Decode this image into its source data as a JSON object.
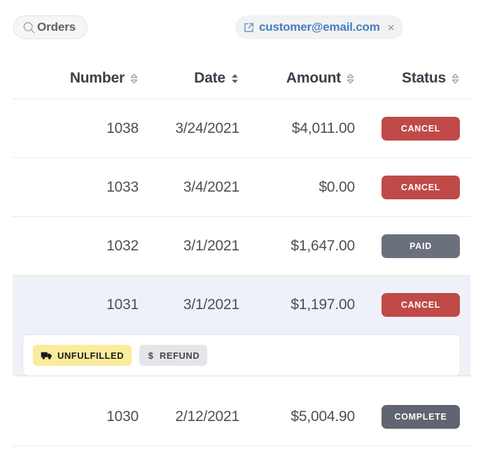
{
  "filter_bar": {
    "search_chip": {
      "icon": "search-icon",
      "label": "Orders"
    },
    "email_chip": {
      "icon": "external-link-icon",
      "label": "customer@email.com",
      "close": "×",
      "accent_color": "#4a7ebb"
    }
  },
  "table": {
    "columns": [
      {
        "key": "number",
        "label": "Number",
        "sort": "none",
        "align": "right"
      },
      {
        "key": "date",
        "label": "Date",
        "sort": "active",
        "align": "right"
      },
      {
        "key": "amount",
        "label": "Amount",
        "sort": "none",
        "align": "right"
      },
      {
        "key": "status",
        "label": "Status",
        "sort": "none",
        "align": "right"
      }
    ],
    "rows": [
      {
        "number": "1038",
        "date": "3/24/2021",
        "amount": "$4,011.00",
        "status": {
          "label": "CANCEL",
          "variant": "cancel",
          "color": "#bf4a48"
        },
        "selected": false,
        "expanded": false
      },
      {
        "number": "1033",
        "date": "3/4/2021",
        "amount": "$0.00",
        "status": {
          "label": "CANCEL",
          "variant": "cancel",
          "color": "#bf4a48"
        },
        "selected": false,
        "expanded": false
      },
      {
        "number": "1032",
        "date": "3/1/2021",
        "amount": "$1,647.00",
        "status": {
          "label": "PAID",
          "variant": "paid",
          "color": "#6b717c"
        },
        "selected": false,
        "expanded": false
      },
      {
        "number": "1031",
        "date": "3/1/2021",
        "amount": "$1,197.00",
        "status": {
          "label": "CANCEL",
          "variant": "cancel",
          "color": "#bf4a48"
        },
        "selected": true,
        "expanded": true,
        "detail": {
          "tags": [
            {
              "icon": "truck-icon",
              "label": "UNFULFILLED",
              "variant": "unfulfilled",
              "color": "#fbeb9c"
            },
            {
              "icon": "dollar-icon",
              "label": "REFUND",
              "variant": "refund",
              "color": "#e4e5e8"
            }
          ]
        }
      },
      {
        "number": "1030",
        "date": "2/12/2021",
        "amount": "$5,004.90",
        "status": {
          "label": "COMPLETE",
          "variant": "complete",
          "color": "#5f6671"
        },
        "selected": false,
        "expanded": false
      }
    ]
  }
}
